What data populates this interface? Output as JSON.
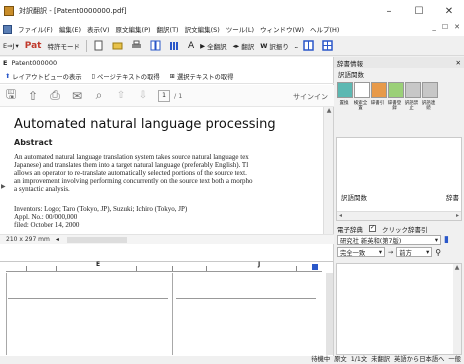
{
  "window": {
    "title": "対訳翻訳 - [Patent0000000.pdf]",
    "controls": [
      "–",
      "☐",
      "✕"
    ]
  },
  "menu": {
    "items": [
      "ファイル(F)",
      "編集(E)",
      "表示(V)",
      "原文編集(P)",
      "翻訳(T)",
      "訳文編集(S)",
      "ツール(L)",
      "ウィンドウ(W)",
      "ヘルプ(H)"
    ],
    "right_controls": [
      "_",
      "☐",
      "✕"
    ]
  },
  "toolbar": {
    "items": [
      "E⇒J",
      "Pat",
      "特許モード",
      "全翻訳",
      "翻訳",
      "訳振り"
    ]
  },
  "doc_pane": {
    "label_prefix": "E",
    "label": "Patent000000",
    "buttons": [
      "レイアウトビューの表示",
      "ページテキストの取得",
      "選択テキストの取得"
    ],
    "page_number": "1",
    "page_total": "/ 1",
    "sign_in": "サインイン",
    "paper_title": "Automated natural language processing",
    "abstract_heading": "Abstract",
    "abstract_lines": [
      "An automated natural language translation system takes source natural language tex",
      "Japanese) and translates them into a target natural language (preferably English). Tl",
      "allows an operator to re-translate automatically selected portions of the source text.",
      "an improvement involving performing concurrently on the source text both a morpho",
      "a syntactic analysis."
    ],
    "biblio_lines": [
      "Inventors:   Logo; Taro (Tokyo, JP), Suzuki; Ichiro (Tokyo, JP)",
      "Appl. No.:   00/000,000",
      "filed:   October 14, 2000"
    ],
    "page_size": "210 x 297 mm"
  },
  "ruler": {
    "left_mark": "E",
    "right_mark": "J"
  },
  "right_panel": {
    "header": "辞書情報",
    "sub_label": "訳語関数",
    "icon_labels": [
      "置換",
      "検索全置",
      "辞書引",
      "辞書登録",
      "訳語禁止",
      "訳語連続"
    ],
    "list_col_left": "訳語関数",
    "list_col_right": "辞書",
    "dict_label": "電子辞典",
    "click_lookup": "クリック辞書引",
    "dict_name": "研究社 新英和(第7版)",
    "match_mode": "完全一致",
    "match_dir": "前方"
  },
  "statusbar": {
    "items": [
      "待機中",
      "原文",
      "1/1文",
      "未翻訳",
      "英語から日本語へ",
      "一般"
    ]
  },
  "colors": {
    "accent_blue": "#2a57c9",
    "link_red": "#c0392b",
    "title_bar": "#ffffff"
  }
}
